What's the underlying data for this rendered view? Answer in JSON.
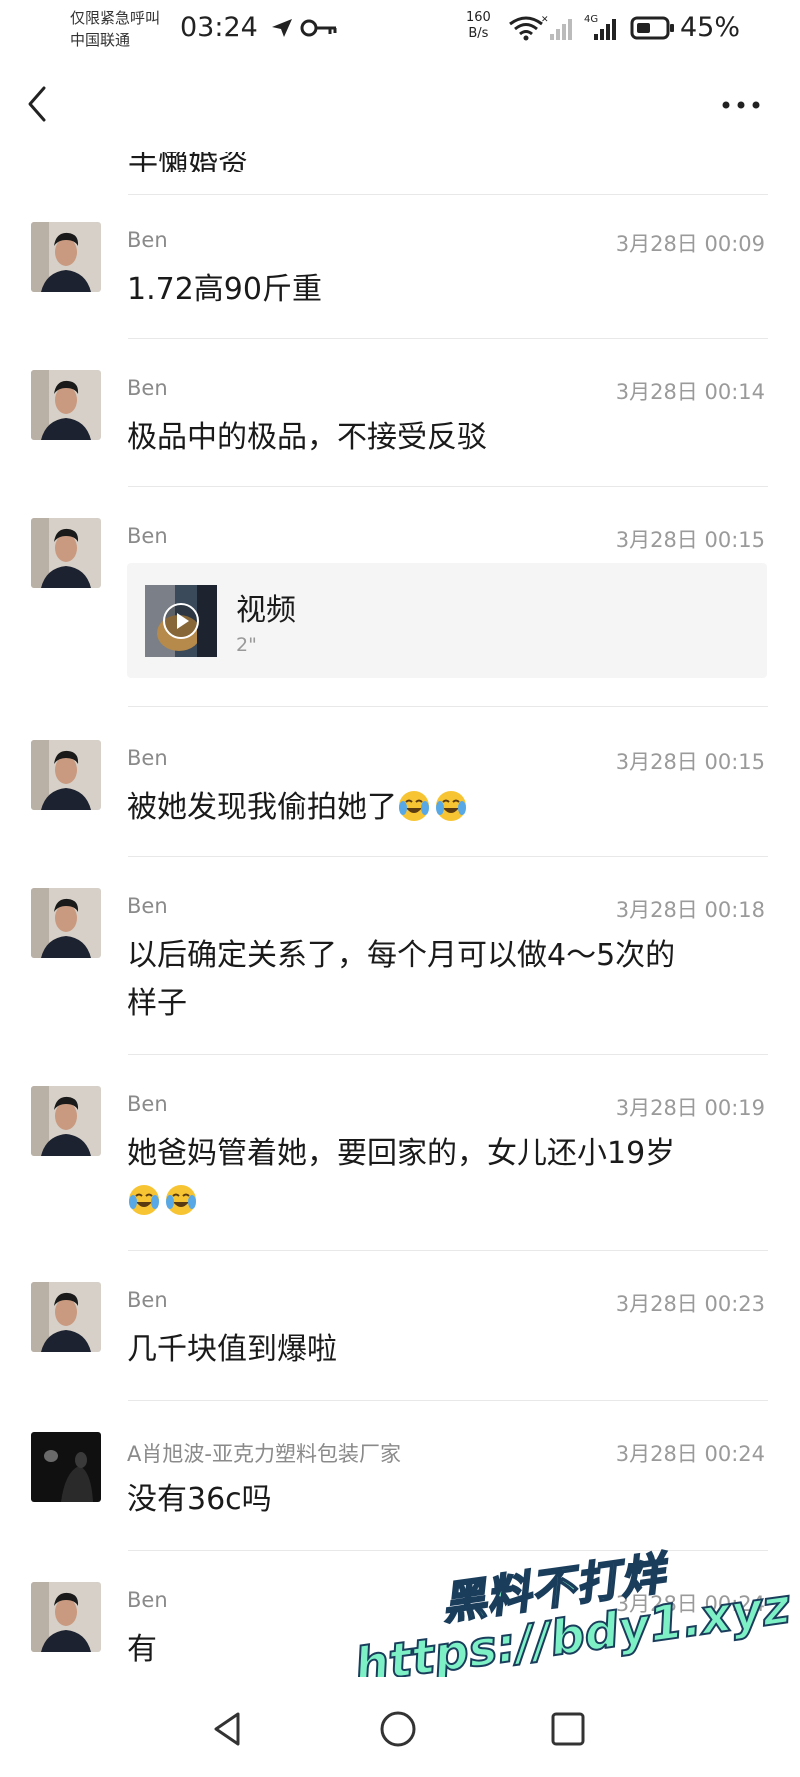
{
  "status_bar": {
    "carrier_line1": "仅限紧急呼叫",
    "carrier_line2": "中国联通",
    "time": "03:24",
    "net_speed_value": "160",
    "net_speed_unit": "B/s",
    "network_type": "4G",
    "battery": "45%"
  },
  "header": {
    "back_icon": "chevron-left-icon",
    "more_icon": "more-horizontal-icon"
  },
  "partial_top_text": "手懶婚资",
  "messages": [
    {
      "sender": "Ben",
      "time": "3月28日 00:09",
      "text": "1.72高90斤重"
    },
    {
      "sender": "Ben",
      "time": "3月28日 00:14",
      "text": "极品中的极品，不接受反驳"
    },
    {
      "sender": "Ben",
      "time": "3月28日 00:15",
      "video": {
        "title": "视频",
        "duration": "2\""
      }
    },
    {
      "sender": "Ben",
      "time": "3月28日 00:15",
      "text": "被她发现我偷拍她了",
      "emoji_count": 2
    },
    {
      "sender": "Ben",
      "time": "3月28日 00:18",
      "text_line1": "以后确定关系了，每个月可以做4～5次的",
      "text_line2": "样子"
    },
    {
      "sender": "Ben",
      "time": "3月28日 00:19",
      "text": "她爸妈管着她，要回家的，女儿还小19岁",
      "emoji_count": 2
    },
    {
      "sender": "Ben",
      "time": "3月28日 00:23",
      "text": "几千块值到爆啦"
    },
    {
      "sender": "A肖旭波-亚克力塑料包装厂家",
      "time": "3月28日 00:24",
      "text": "没有36c吗"
    },
    {
      "sender": "Ben",
      "time": "3月28日 00:24",
      "text": "有"
    }
  ],
  "watermark": {
    "line1": "黑料不打烊",
    "line2": "https://bdy1.xyz"
  },
  "nav": {
    "back": "triangle-back-icon",
    "home": "circle-home-icon",
    "recents": "square-recents-icon"
  },
  "colors": {
    "watermark_fill": "#7df0c5",
    "watermark_stroke": "#1a3d5c",
    "card_bg": "#f5f5f5"
  }
}
